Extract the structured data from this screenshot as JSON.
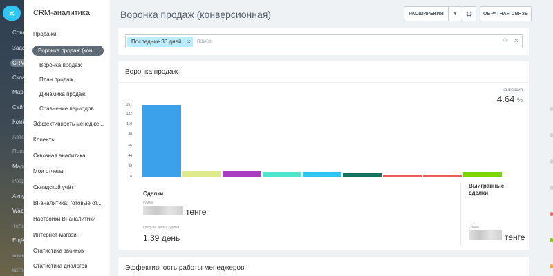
{
  "left_strip": {
    "menu_label": "×",
    "items": [
      {
        "label": "Сове",
        "state": "normal"
      },
      {
        "label": "Зада",
        "state": "normal"
      },
      {
        "label": "CRM",
        "state": "active"
      },
      {
        "label": "Скла",
        "state": "normal"
      },
      {
        "label": "Мар",
        "state": "normal"
      },
      {
        "label": "Сайт",
        "state": "normal"
      },
      {
        "label": "Комі",
        "state": "normal"
      },
      {
        "label": "Авто",
        "state": "dim"
      },
      {
        "label": "Прил",
        "state": "dim"
      },
      {
        "label": "Мар",
        "state": "normal"
      },
      {
        "label": "Разр",
        "state": "dim"
      },
      {
        "label": "Aimy",
        "state": "normal"
      },
      {
        "label": "Waza",
        "state": "normal"
      },
      {
        "label": "Теле",
        "state": "dim"
      },
      {
        "label": "Ещё",
        "state": "normal"
      },
      {
        "label": "коме",
        "state": "dim"
      },
      {
        "label": "ката",
        "state": "dim"
      },
      {
        "label": "наза",
        "state": "dim"
      }
    ]
  },
  "sidebar": {
    "title": "CRM-аналитика",
    "items": [
      {
        "label": "Продажи",
        "type": "section"
      },
      {
        "label": "Воронка продаж (кон...",
        "type": "active"
      },
      {
        "label": "Воронка продаж",
        "type": "sub"
      },
      {
        "label": "План продаж",
        "type": "sub"
      },
      {
        "label": "Динамика продаж",
        "type": "sub"
      },
      {
        "label": "Сравнение периодов",
        "type": "sub"
      },
      {
        "label": "Эффективность менедже...",
        "type": "section"
      },
      {
        "label": "Клиенты",
        "type": "section"
      },
      {
        "label": "Сквозная аналитика",
        "type": "section"
      },
      {
        "label": "Мои отчеты",
        "type": "section"
      },
      {
        "label": "Складской учёт",
        "type": "section"
      },
      {
        "label": "BI-аналитика: готовые от...",
        "type": "section"
      },
      {
        "label": "Настройки BI-аналитики",
        "type": "section"
      },
      {
        "label": "Интернет-магазин",
        "type": "section"
      },
      {
        "label": "Статистика звонков",
        "type": "section"
      },
      {
        "label": "Статистика диалогов",
        "type": "section"
      }
    ]
  },
  "header": {
    "title": "Воронка продаж (конверсионная)",
    "extensions_label": "РАСШИРЕНИЯ",
    "feedback_label": "ОБРАТНАЯ СВЯЗЬ"
  },
  "filter": {
    "chip_label": "Последние 30 дней",
    "search_placeholder": "+ поиск"
  },
  "funnel": {
    "title": "Воронка продаж",
    "conversion_label": "конверсия",
    "conversion_value": "4.64",
    "conversion_unit": "%",
    "deals_heading": "Сделки",
    "sum_label": "сумма",
    "currency": "тенге",
    "avg_time_label": "среднее время сделки",
    "avg_time_value": "1.39 день",
    "won_heading": "Выигранные сделки",
    "won_sum_label": "сумма",
    "won_currency": "тенге"
  },
  "chart_data": {
    "type": "bar",
    "yticks": [
      151,
      132,
      110,
      88,
      66,
      44,
      22,
      0
    ],
    "ylim": [
      0,
      151
    ],
    "values": [
      151,
      12,
      11,
      10,
      8,
      7,
      1,
      1,
      8
    ],
    "colors": [
      "#3aa1ea",
      "#dfea8c",
      "#ab3ec0",
      "#4fe5cc",
      "#2dc4ef",
      "#14715f",
      "#f05b5b",
      "#f05b5b",
      "#7bd500"
    ]
  },
  "managers": {
    "title": "Эффективность работы менеджеров"
  }
}
